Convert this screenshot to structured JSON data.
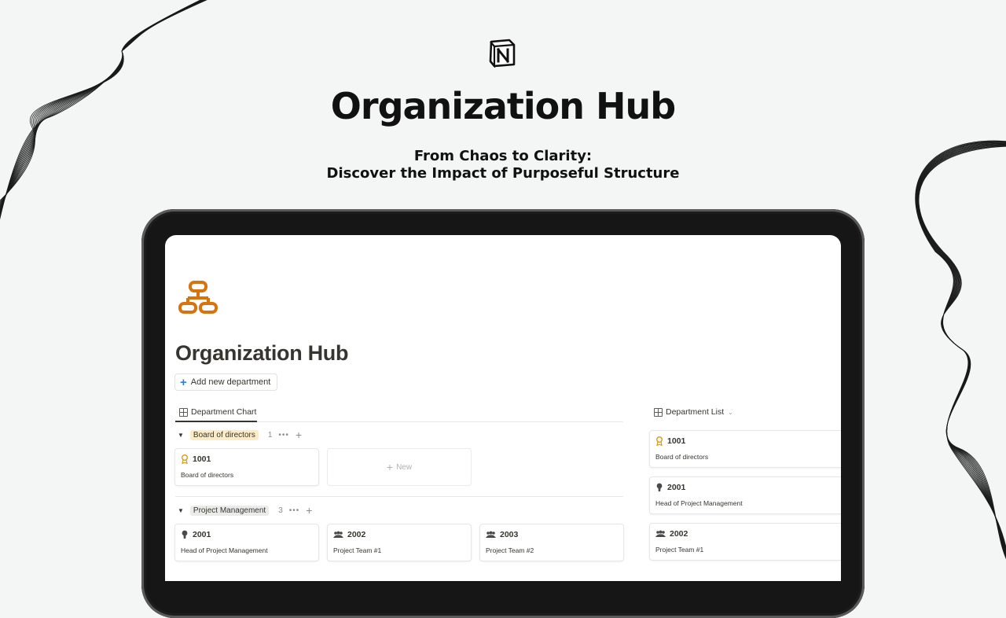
{
  "hero": {
    "title": "Organization Hub",
    "subtitle_line1": "From Chaos to Clarity:",
    "subtitle_line2": "Discover the Impact of Purposeful Structure"
  },
  "page": {
    "title": "Organization Hub",
    "add_button_label": "Add new department",
    "icon": "org-chart-icon"
  },
  "views": {
    "chart_tab": "Department Chart",
    "list_tab": "Department List"
  },
  "groups": [
    {
      "label": "Board of directors",
      "count": "1",
      "color": "#fbecc7",
      "cards": [
        {
          "id": "1001",
          "name": "Board of directors",
          "icon": "award-icon"
        }
      ],
      "new_label": "New"
    },
    {
      "label": "Project Management",
      "count": "3",
      "color": "#ebebea",
      "cards": [
        {
          "id": "2001",
          "name": "Head of Project Management",
          "icon": "person-icon"
        },
        {
          "id": "2002",
          "name": "Project Team #1",
          "icon": "group-icon"
        },
        {
          "id": "2003",
          "name": "Project Team #2",
          "icon": "group-icon"
        }
      ]
    }
  ],
  "list": [
    {
      "id": "1001",
      "name": "Board of directors",
      "icon": "award-icon"
    },
    {
      "id": "2001",
      "name": "Head of Project Management",
      "icon": "person-icon"
    },
    {
      "id": "2002",
      "name": "Project Team #1",
      "icon": "group-icon"
    }
  ],
  "colors": {
    "accent_orange": "#d9730d",
    "blue_plus": "#2f7fd6"
  }
}
